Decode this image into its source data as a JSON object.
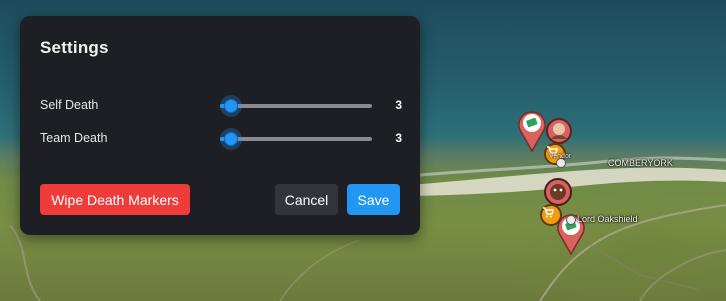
{
  "settings": {
    "title": "Settings",
    "sliders": [
      {
        "label": "Self Death",
        "value": "3",
        "level": 0.07
      },
      {
        "label": "Team Death",
        "value": "3",
        "level": 0.07
      }
    ],
    "buttons": {
      "wipe_label": "Wipe Death Markers",
      "cancel_label": "Cancel",
      "save_label": "Save"
    }
  },
  "map": {
    "labels": [
      {
        "text": "Vendor"
      },
      {
        "text": "COMBERYORK"
      },
      {
        "text": "Lord Oakshield"
      }
    ]
  },
  "colors": {
    "accent": "#2196f3",
    "danger": "#f03b3b",
    "modal_bg": "#1e1f24",
    "marker_pin": "#d9615f",
    "cart_badge": "#f39c12"
  },
  "icons": [
    "money-marker-icon",
    "player-portrait-icon",
    "vendor-cart-icon",
    "beaver-marker-icon"
  ]
}
